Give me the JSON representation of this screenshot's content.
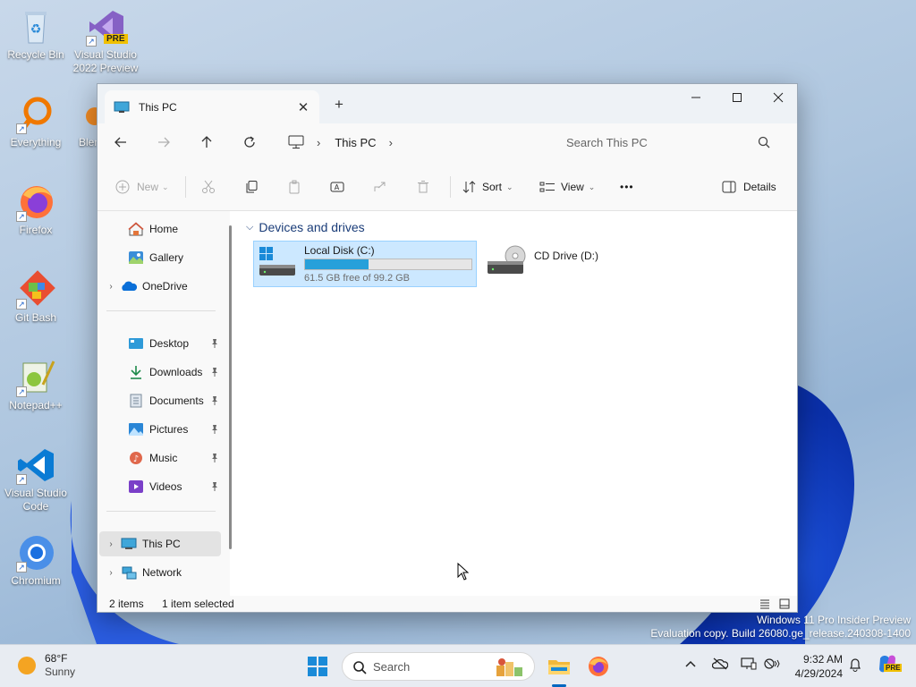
{
  "desktop": {
    "icons": [
      {
        "label": "Recycle Bin"
      },
      {
        "label": "Visual Studio 2022 Preview",
        "badge": "PRE"
      },
      {
        "label": "Everything"
      },
      {
        "label": "Blender"
      },
      {
        "label": "Firefox"
      },
      {
        "label": "Git Bash"
      },
      {
        "label": "Notepad++"
      },
      {
        "label": "Visual Studio Code"
      },
      {
        "label": "Chromium"
      }
    ],
    "partial_label": "Blen"
  },
  "explorer": {
    "tab_title": "This PC",
    "breadcrumb": "This PC",
    "search_placeholder": "Search This PC",
    "toolbar": {
      "new": "New",
      "sort": "Sort",
      "view": "View",
      "more": "•••",
      "details": "Details"
    },
    "sidebar": {
      "quick": [
        {
          "label": "Home"
        },
        {
          "label": "Gallery"
        },
        {
          "label": "OneDrive"
        }
      ],
      "pinned": [
        {
          "label": "Desktop"
        },
        {
          "label": "Downloads"
        },
        {
          "label": "Documents"
        },
        {
          "label": "Pictures"
        },
        {
          "label": "Music"
        },
        {
          "label": "Videos"
        }
      ],
      "locations": [
        {
          "label": "This PC"
        },
        {
          "label": "Network"
        }
      ]
    },
    "content": {
      "group_title": "Devices and drives",
      "drives": [
        {
          "name": "Local Disk (C:)",
          "free_text": "61.5 GB free of 99.2 GB",
          "used_fraction": 0.38
        },
        {
          "name": "CD Drive (D:)"
        }
      ]
    },
    "status": {
      "items": "2 items",
      "selected": "1 item selected"
    }
  },
  "watermark": {
    "line1": "Windows 11 Pro Insider Preview",
    "line2": "Evaluation copy. Build 26080.ge_release.240308-1400"
  },
  "taskbar": {
    "weather_temp": "68°F",
    "weather_desc": "Sunny",
    "search_label": "Search",
    "time": "9:32 AM",
    "date": "4/29/2024",
    "copilot_badge": "PRE"
  },
  "colors": {
    "accent": "#0067c0",
    "selection": "#cce8ff",
    "drive_bar": "#26a0da"
  }
}
